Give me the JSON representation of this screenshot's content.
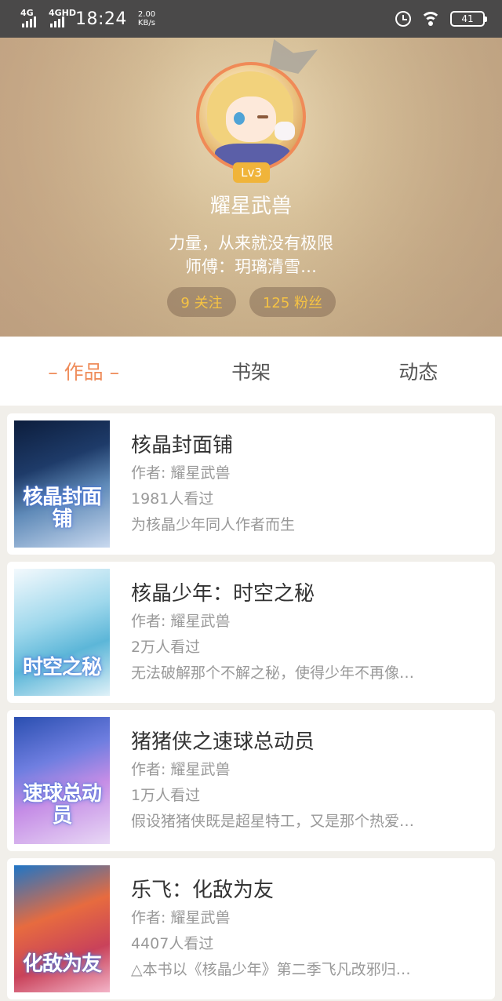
{
  "status_bar": {
    "signal_1": "4G",
    "signal_2": "4GHD",
    "time": "18:24",
    "speed_value": "2.00",
    "speed_unit": "KB/s",
    "battery": "41"
  },
  "profile": {
    "level": "Lv3",
    "username": "耀星武兽",
    "motto": "力量，从来就没有极限",
    "master": "师傅：玥璃清雪…",
    "following": "9 关注",
    "followers": "125 粉丝"
  },
  "tabs": [
    {
      "label": "– 作品 –",
      "active": true
    },
    {
      "label": "书架",
      "active": false
    },
    {
      "label": "动态",
      "active": false
    }
  ],
  "works": [
    {
      "cover_text": "核晶封面铺",
      "title": "核晶封面铺",
      "author": "作者: 耀星武兽",
      "views": "1981人看过",
      "description": "为核晶少年同人作者而生"
    },
    {
      "cover_text": "时空之秘",
      "title": "核晶少年：时空之秘",
      "author": "作者: 耀星武兽",
      "views": "2万人看过",
      "description": "无法破解那个不解之秘，使得少年不再像…"
    },
    {
      "cover_text": "速球总动员",
      "title": "猪猪侠之速球总动员",
      "author": "作者: 耀星武兽",
      "views": "1万人看过",
      "description": "假设猪猪侠既是超星特工，又是那个热爱…"
    },
    {
      "cover_text": "化敌为友",
      "title": "乐飞：化敌为友",
      "author": "作者: 耀星武兽",
      "views": "4407人看过",
      "description": "△本书以《核晶少年》第二季飞凡改邪归…"
    }
  ]
}
